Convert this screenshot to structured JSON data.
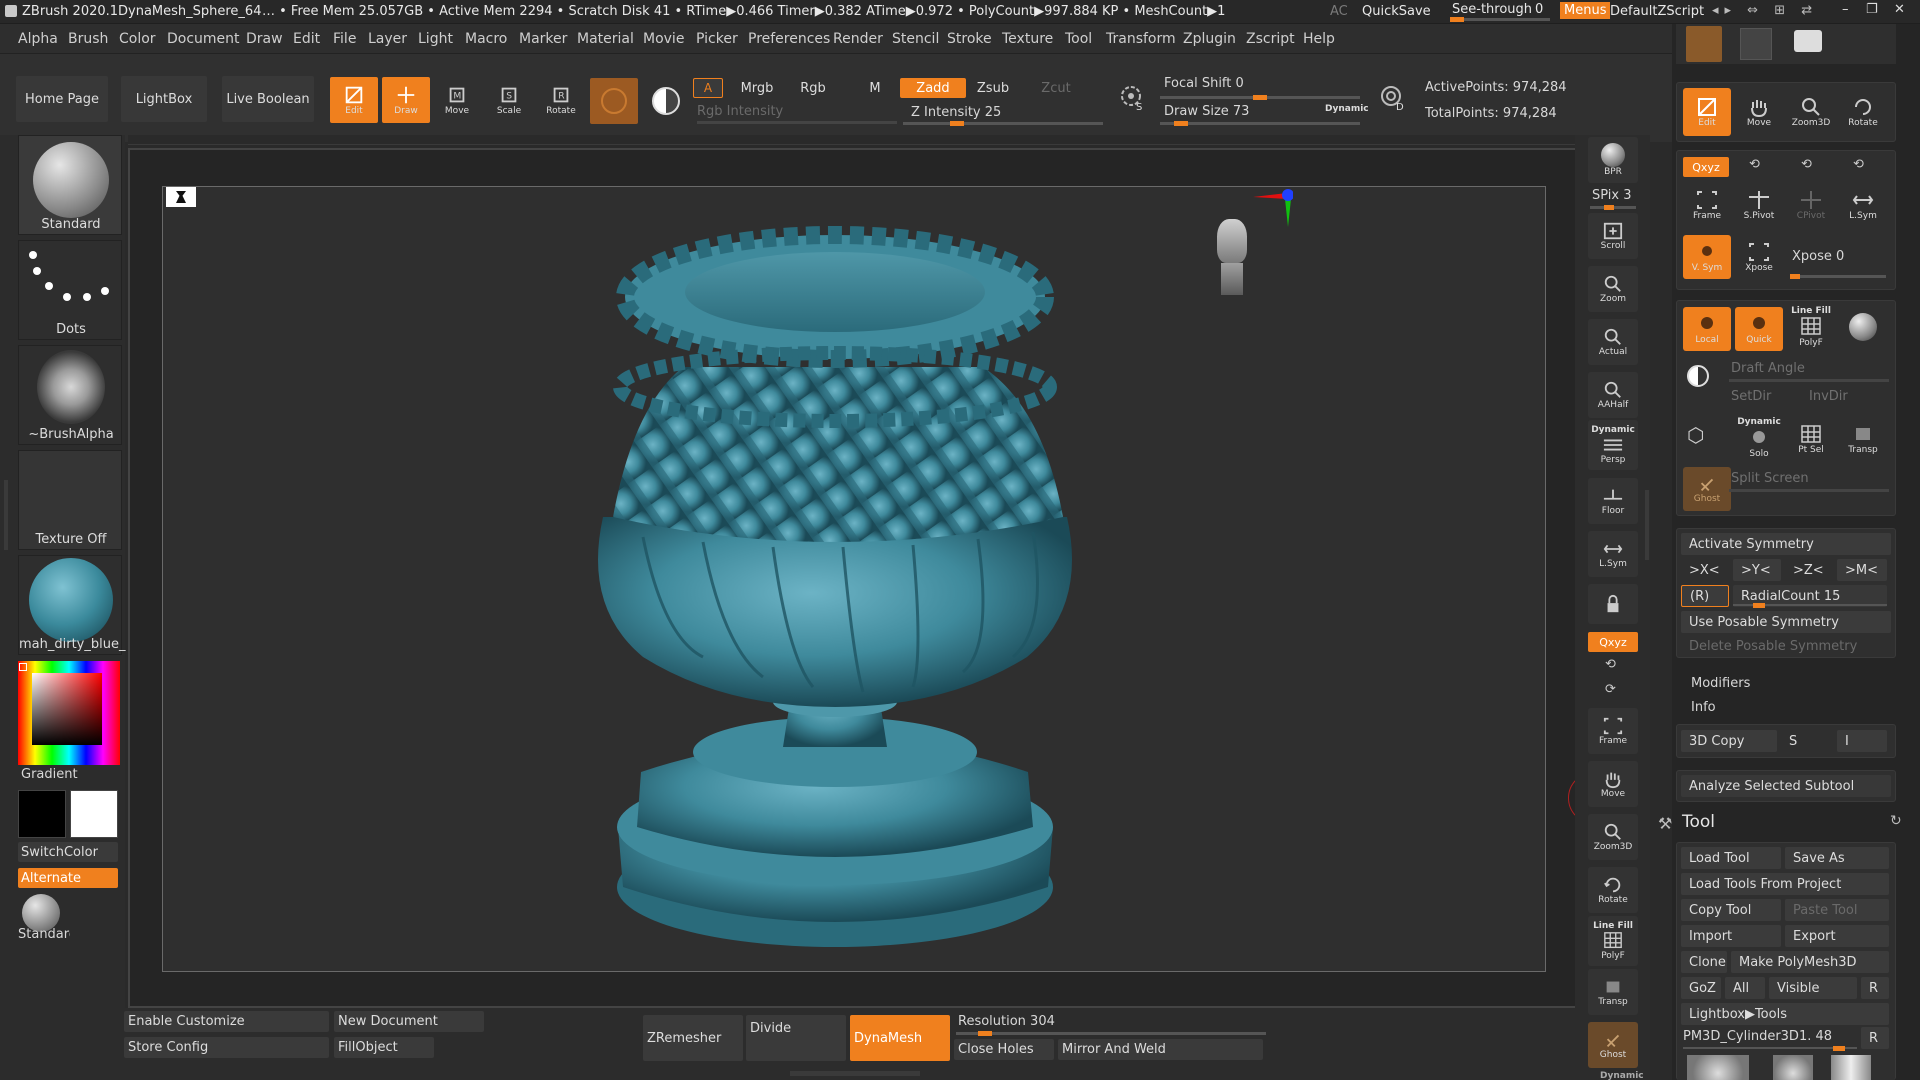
{
  "titlebar": {
    "app": "ZBrush 2020.1",
    "doc": "DynaMesh_Sphere_64",
    "stats": "… • Free Mem 25.057GB • Active Mem 2294 • Scratch Disk 41 •  RTime▶0.466 Timer▶0.382 ATime▶0.972 • PolyCount▶997.884 KP  • MeshCount▶1",
    "ac": "AC",
    "quicksave": "QuickSave",
    "seethrough": "See-through",
    "seethrough_value": "0",
    "menus": "Menus",
    "zscript": "DefaultZScript"
  },
  "menubar": [
    "Alpha",
    "Brush",
    "Color",
    "Document",
    "Draw",
    "Edit",
    "File",
    "Layer",
    "Light",
    "Macro",
    "Marker",
    "Material",
    "Movie",
    "Picker",
    "Preferences",
    "Render",
    "Stencil",
    "Stroke",
    "Texture",
    "Tool",
    "Transform",
    "Zplugin",
    "Zscript",
    "Help"
  ],
  "topshelf": {
    "home": "Home Page",
    "lightbox": "LightBox",
    "liveboolean": "Live Boolean",
    "edit": "Edit",
    "draw": "Draw",
    "move": "Move",
    "scale": "Scale",
    "rotate": "Rotate",
    "a": "A",
    "mrgb": "Mrgb",
    "rgb": "Rgb",
    "m": "M",
    "zadd": "Zadd",
    "zsub": "Zsub",
    "zcut": "Zcut",
    "rgb_intensity": "Rgb Intensity",
    "z_intensity": "Z Intensity 25",
    "z_intensity_value": 25,
    "focal_shift": "Focal Shift 0",
    "focal_shift_value": 0,
    "draw_size": "Draw Size 73",
    "draw_size_value": 73,
    "dynamic": "Dynamic",
    "active_points": "ActivePoints: 974,284",
    "total_points": "TotalPoints: 974,284",
    "s": "S",
    "d": "D"
  },
  "leftshelf": {
    "brush": "Standard",
    "stroke": "Dots",
    "alpha": "~BrushAlpha",
    "texture": "Texture Off",
    "material": "mah_dirty_blue_",
    "gradient": "Gradient",
    "switchcolor": "SwitchColor",
    "alternate": "Alternate",
    "brush2": "Standard"
  },
  "rightshelf": {
    "bpr": "BPR",
    "spix": "SPix 3",
    "spix_value": 3,
    "scroll": "Scroll",
    "zoom": "Zoom",
    "actual": "Actual",
    "aahalf": "AAHalf",
    "dynamic": "Dynamic",
    "persp": "Persp",
    "floor": "Floor",
    "lsym": "L.Sym",
    "xyz": "Qxyz",
    "frame": "Frame",
    "move": "Move",
    "zoom3d": "Zoom3D",
    "rotate": "Rotate",
    "linefill": "Line Fill",
    "polyf": "PolyF",
    "transp": "Transp",
    "ghost": "Ghost",
    "dynamic2": "Dynamic"
  },
  "rightpanel": {
    "edit": "Edit",
    "move": "Move",
    "zoom3d": "Zoom3D",
    "rotate": "Rotate",
    "xyz": "Qxyz",
    "frame": "Frame",
    "spivot": "S.Pivot",
    "cpivot": "CPivot",
    "lsym": "L.Sym",
    "vsym": "V. Sym",
    "xpose": "Xpose",
    "xpose_label": "Xpose 0",
    "xpose_value": 0,
    "local": "Local",
    "quick": "Quick",
    "linefill": "Line Fill",
    "polyf": "PolyF",
    "draft_angle": "Draft Angle",
    "setdir": "SetDir",
    "invdir": "InvDir",
    "dynamic": "Dynamic",
    "solo": "Solo",
    "ptsel": "Pt Sel",
    "transp": "Transp",
    "split_screen": "Split Screen",
    "ghost": "Ghost",
    "activate_symmetry": "Activate Symmetry",
    "x": ">X<",
    "y": ">Y<",
    "z": ">Z<",
    "m": ">M<",
    "r": "(R)",
    "radialcount": "RadialCount 15",
    "radialcount_value": 15,
    "posable": "Use Posable Symmetry",
    "delete_posable": "Delete Posable Symmetry",
    "modifiers": "Modifiers",
    "info": "Info",
    "copy3d": "3D Copy",
    "s": "S",
    "i": "I",
    "analyze": "Analyze Selected Subtool",
    "tool_title": "Tool",
    "load_tool": "Load Tool",
    "save_as": "Save As",
    "load_from_project": "Load Tools From Project",
    "copy_tool": "Copy Tool",
    "paste_tool": "Paste Tool",
    "import": "Import",
    "export": "Export",
    "clone": "Clone",
    "make_polymesh": "Make PolyMesh3D",
    "goz": "GoZ",
    "all": "All",
    "visible": "Visible",
    "r2": "R",
    "lightbox_tools": "Lightbox▶Tools",
    "current_tool": "PM3D_Cylinder3D1. 48",
    "r3": "R"
  },
  "bottombar": {
    "enable_customize": "Enable Customize",
    "new_document": "New Document",
    "store_config": "Store Config",
    "fillobject": "FillObject",
    "zremesher": "ZRemesher",
    "divide": "Divide",
    "dynamesh": "DynaMesh",
    "resolution": "Resolution 304",
    "resolution_value": 304,
    "close_holes": "Close Holes",
    "mirror_weld": "Mirror And Weld"
  },
  "colors": {
    "accent": "#f0801e",
    "mesh": "#3f8a9c",
    "background": "#2a2a2a"
  }
}
